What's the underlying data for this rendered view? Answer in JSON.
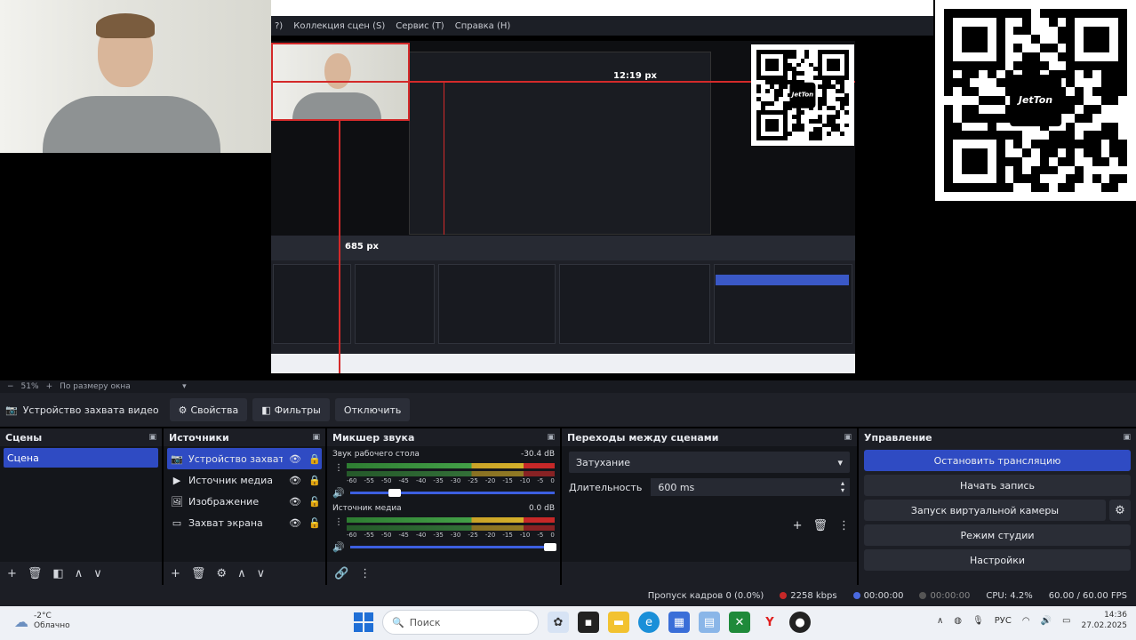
{
  "preview": {
    "nested_menu": [
      "Коллекция сцен (S)",
      "Сервис (T)",
      "Справка (H)"
    ],
    "nested_menu_prefix": "?)",
    "px_label_top": "12:19 px",
    "px_label_left": "685 px",
    "qr_logo_text": "JetTon"
  },
  "zoom": {
    "value": "51%",
    "mode": "По размеру окна"
  },
  "source_toolbar": {
    "source_name": "Устройство захвата видео",
    "properties": "Свойства",
    "filters": "Фильтры",
    "disable": "Отключить"
  },
  "scenes": {
    "title": "Сцены",
    "items": [
      "Сцена"
    ]
  },
  "sources": {
    "title": "Источники",
    "items": [
      {
        "name": "Устройство захвата в",
        "icon": "camera-icon"
      },
      {
        "name": "Источник медиа",
        "icon": "play-icon"
      },
      {
        "name": "Изображение",
        "icon": "image-icon"
      },
      {
        "name": "Захват экрана",
        "icon": "monitor-icon"
      }
    ]
  },
  "mixer": {
    "title": "Микшер звука",
    "channels": [
      {
        "name": "Звук рабочего стола",
        "db": "-30.4 dB",
        "level": 0.22
      },
      {
        "name": "Источник медиа",
        "db": "0.0 dB",
        "level": 0.98
      }
    ],
    "ticks": [
      "-60",
      "-55",
      "-50",
      "-45",
      "-40",
      "-35",
      "-30",
      "-25",
      "-20",
      "-15",
      "-10",
      "-5",
      "0"
    ]
  },
  "transitions": {
    "title": "Переходы между сценами",
    "selected": "Затухание",
    "duration_label": "Длительность",
    "duration_value": "600 ms"
  },
  "controls": {
    "title": "Управление",
    "stop_stream": "Остановить трансляцию",
    "start_record": "Начать запись",
    "virtual_cam": "Запуск виртуальной камеры",
    "studio_mode": "Режим студии",
    "settings": "Настройки"
  },
  "status": {
    "dropped": "Пропуск кадров 0 (0.0%)",
    "bitrate": "2258 kbps",
    "stream_time": "00:00:00",
    "rec_time": "00:00:00",
    "cpu": "CPU: 4.2%",
    "fps": "60.00 / 60.00 FPS"
  },
  "taskbar": {
    "weather_temp": "-2°C",
    "weather_text": "Облачно",
    "search_placeholder": "Поиск",
    "lang": "РУС",
    "time": "14:36",
    "date": "27.02.2025"
  },
  "colors": {
    "accent": "#2f4bc3",
    "selection_red": "#d42a2a"
  }
}
